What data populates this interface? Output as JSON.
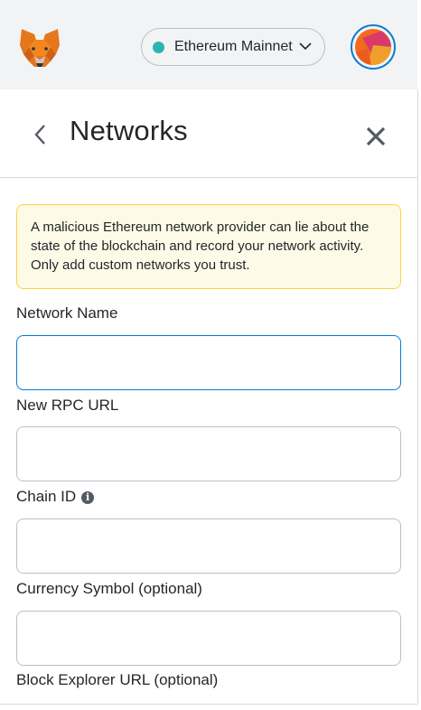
{
  "header": {
    "network": {
      "name": "Ethereum Mainnet",
      "status_color": "#29b6af"
    },
    "icons": {
      "logo": "metamask-fox-icon",
      "chevron": "chevron-down-icon",
      "avatar": "account-avatar-icon"
    }
  },
  "page": {
    "title": "Networks",
    "icons": {
      "back": "chevron-left-icon",
      "close": "close-icon"
    }
  },
  "warning": {
    "text": "A malicious Ethereum network provider can lie about the state of the blockchain and record your network activity. Only add custom networks you trust."
  },
  "form": {
    "network_name": {
      "label": "Network Name",
      "value": "",
      "placeholder": ""
    },
    "rpc_url": {
      "label": "New RPC URL",
      "value": "",
      "placeholder": ""
    },
    "chain_id": {
      "label": "Chain ID",
      "value": "",
      "placeholder": "",
      "info_icon_glyph": "i"
    },
    "currency_symbol": {
      "label": "Currency Symbol (optional)",
      "value": "",
      "placeholder": ""
    },
    "block_explorer": {
      "label": "Block Explorer URL (optional)"
    }
  },
  "colors": {
    "accent": "#037dd6",
    "warning_bg": "#fefae8",
    "warning_border": "#ffd33d",
    "header_bg": "#f2f3f4"
  }
}
